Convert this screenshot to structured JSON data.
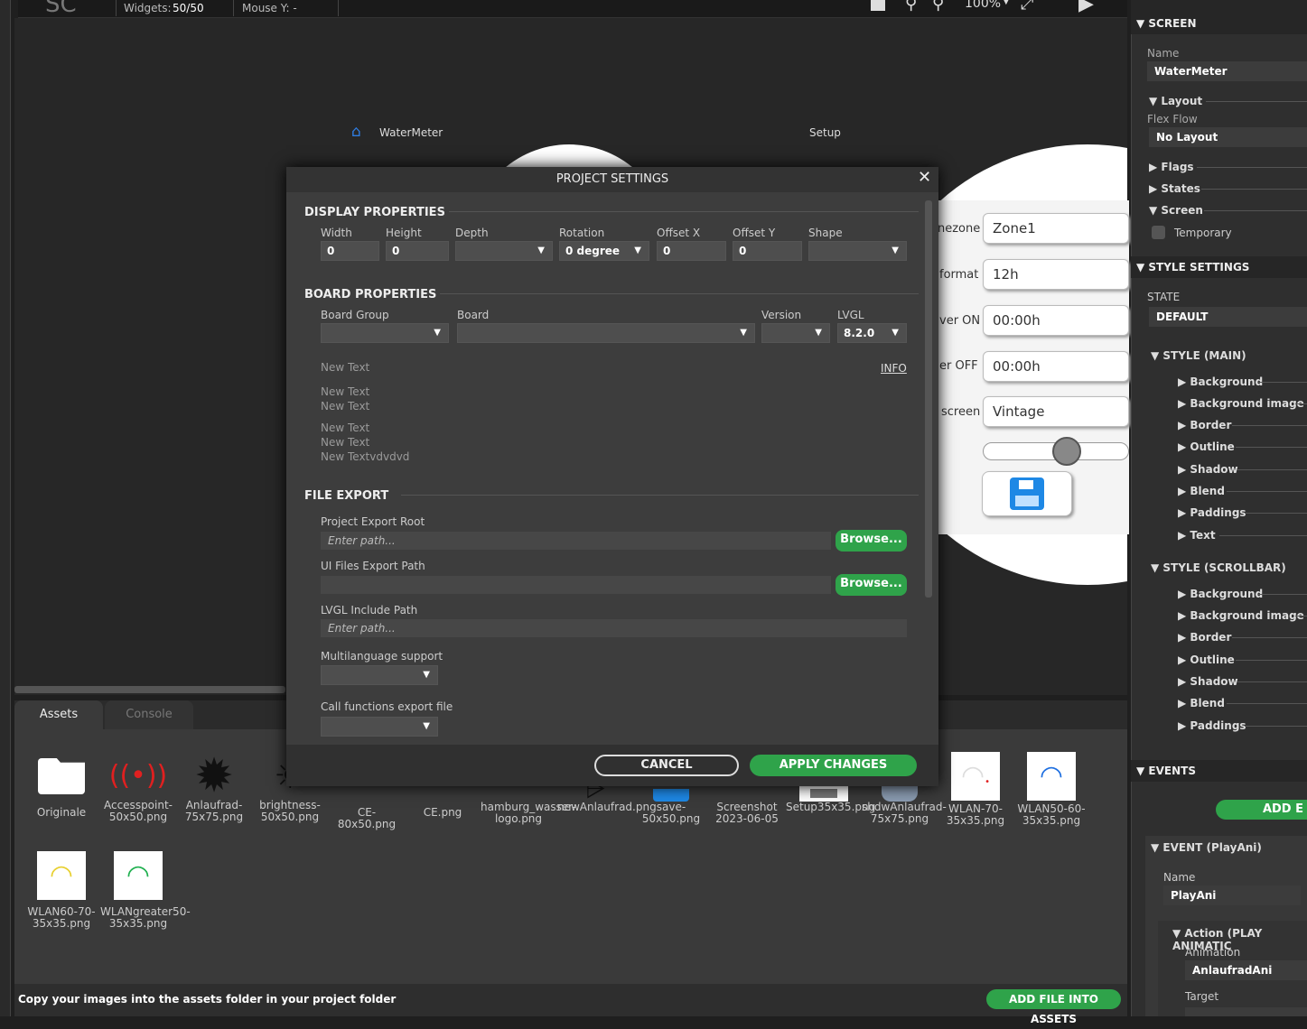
{
  "topbar": {
    "widgets_label": "Widgets:",
    "widgets_value": "50/50",
    "mouse_y": "Mouse Y: -",
    "zoom": "100%"
  },
  "device": {
    "home_label": "WaterMeter",
    "setup_label": "Setup",
    "rows": [
      {
        "label": "nezone",
        "value": "Zone1"
      },
      {
        "label": "format",
        "value": "12h"
      },
      {
        "label": "ver ON",
        "value": "00:00h"
      },
      {
        "label": "er OFF",
        "value": "00:00h"
      },
      {
        "label": "screen",
        "value": "Vintage"
      }
    ],
    "colors": {
      "accent": "#2f7de1",
      "save_icon": "#1e88e5"
    }
  },
  "modal": {
    "title": "PROJECT SETTINGS",
    "display": {
      "heading": "DISPLAY PROPERTIES",
      "width_label": "Width",
      "width_value": "0",
      "height_label": "Height",
      "height_value": "0",
      "depth_label": "Depth",
      "depth_value": "",
      "rotation_label": "Rotation",
      "rotation_value": "0 degree",
      "offx_label": "Offset X",
      "offx_value": "0",
      "offy_label": "Offset Y",
      "offy_value": "0",
      "shape_label": "Shape",
      "shape_value": ""
    },
    "board": {
      "heading": "BOARD PROPERTIES",
      "group_label": "Board Group",
      "board_label": "Board",
      "version_label": "Version",
      "lvgl_label": "LVGL",
      "lvgl_value": "8.2.0",
      "info_link": "INFO",
      "texts": [
        "New Text",
        "New Text",
        "New Text",
        "New Text",
        "New Text",
        "New Textvdvdvd"
      ]
    },
    "export": {
      "heading": "FILE EXPORT",
      "root_label": "Project Export Root",
      "root_placeholder": "Enter path...",
      "ui_label": "UI Files Export Path",
      "lvgl_label": "LVGL Include Path",
      "lvgl_placeholder": "Enter path...",
      "multi_label": "Multilanguage support",
      "call_label": "Call functions export file",
      "browse": "Browse..."
    },
    "cancel": "CANCEL",
    "apply": "APPLY CHANGES"
  },
  "bottom": {
    "tabs": [
      "Assets",
      "Console"
    ],
    "assets": [
      {
        "name": "Originale",
        "icon": "folder-icon"
      },
      {
        "name": "Accesspoint-50x50.png",
        "icon": "access-point-icon"
      },
      {
        "name": "Anlaufrad-75x75.png",
        "icon": "gear-icon"
      },
      {
        "name": "brightness-50x50.png",
        "icon": "brightness-icon"
      },
      {
        "name": "CE-80x50.png",
        "icon": "image-icon"
      },
      {
        "name": "CE.png",
        "icon": "image-icon"
      },
      {
        "name": "hamburg_wasser-logo.png",
        "icon": "image-icon"
      },
      {
        "name": "newAnlaufrad.png",
        "icon": "gear-icon"
      },
      {
        "name": "save-50x50.png",
        "icon": "save-icon"
      },
      {
        "name": "Screenshot 2023-06-05",
        "icon": "image-icon"
      },
      {
        "name": "Setup35x35.png",
        "icon": "gear-icon"
      },
      {
        "name": "shdwAnlaufrad-75x75.png",
        "icon": "gear-icon"
      },
      {
        "name": "WLAN-70-35x35.png",
        "icon": "wifi-icon"
      },
      {
        "name": "WLAN50-60-35x35.png",
        "icon": "wifi-icon"
      },
      {
        "name": "WLAN60-70-35x35.png",
        "icon": "wifi-icon"
      },
      {
        "name": "WLANgreater50-35x35.png",
        "icon": "wifi-icon"
      }
    ],
    "status_text": "Copy your images into the assets folder in your project folder",
    "add_button": "ADD FILE INTO ASSETS"
  },
  "right": {
    "screen_heading": "SCREEN",
    "name_label": "Name",
    "name_value": "WaterMeter",
    "layout": "Layout",
    "flex_label": "Flex Flow",
    "flex_value": "No Layout",
    "flags": "Flags",
    "states": "States",
    "screen_sub": "Screen",
    "temporary": "Temporary",
    "style_heading": "STYLE SETTINGS",
    "state_label": "STATE",
    "state_value": "DEFAULT",
    "style_main": "STYLE (MAIN)",
    "main_items": [
      "Background",
      "Background image",
      "Border",
      "Outline",
      "Shadow",
      "Blend",
      "Paddings",
      "Text"
    ],
    "style_scroll": "STYLE (SCROLLBAR)",
    "scroll_items": [
      "Background",
      "Background image",
      "Border",
      "Outline",
      "Shadow",
      "Blend",
      "Paddings"
    ],
    "events_heading": "EVENTS",
    "add_event": "ADD E",
    "event_title": "EVENT (PlayAni)",
    "event_name_label": "Name",
    "event_name_value": "PlayAni",
    "action": "Action (PLAY ANIMATIC",
    "anim_label": "Animation",
    "anim_value": "AnlaufradAni",
    "target_label": "Target"
  }
}
